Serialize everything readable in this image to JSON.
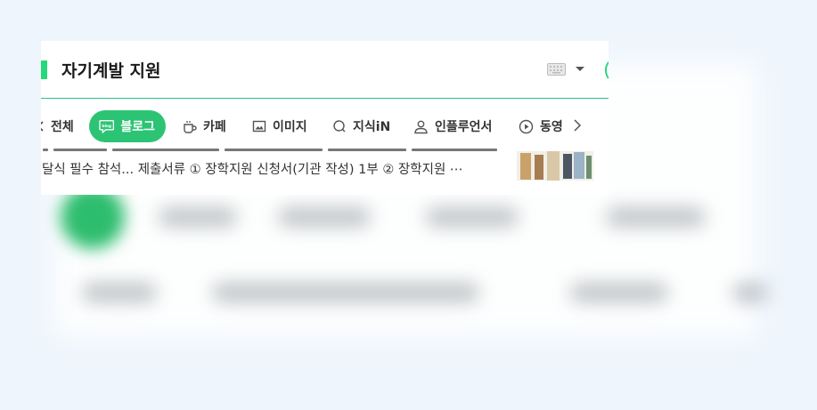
{
  "search": {
    "query": "자기계발 지원",
    "accent_color": "#27d87a"
  },
  "tabs": [
    {
      "label": "전체",
      "icon": "all-icon",
      "active": false
    },
    {
      "label": "블로그",
      "icon": "blog-icon",
      "active": true
    },
    {
      "label": "카페",
      "icon": "cafe-cup-icon",
      "active": false
    },
    {
      "label": "이미지",
      "icon": "image-icon",
      "active": false
    },
    {
      "label": "지식iN",
      "icon": "knowledge-search-icon",
      "active": false
    },
    {
      "label": "인플루언서",
      "icon": "person-icon",
      "active": false
    },
    {
      "label": "동영",
      "icon": "play-circle-icon",
      "active": false
    }
  ],
  "blog_badge": "blog",
  "snippet": {
    "line": "달식 필수 참석... 제출서류 ① 장학지원 신청서(기관 작성) 1부 ② 장학지원 ⋯"
  },
  "colors": {
    "active_tab": "#2cc474",
    "divider": "#27c48a",
    "background": "#eef5fc"
  }
}
